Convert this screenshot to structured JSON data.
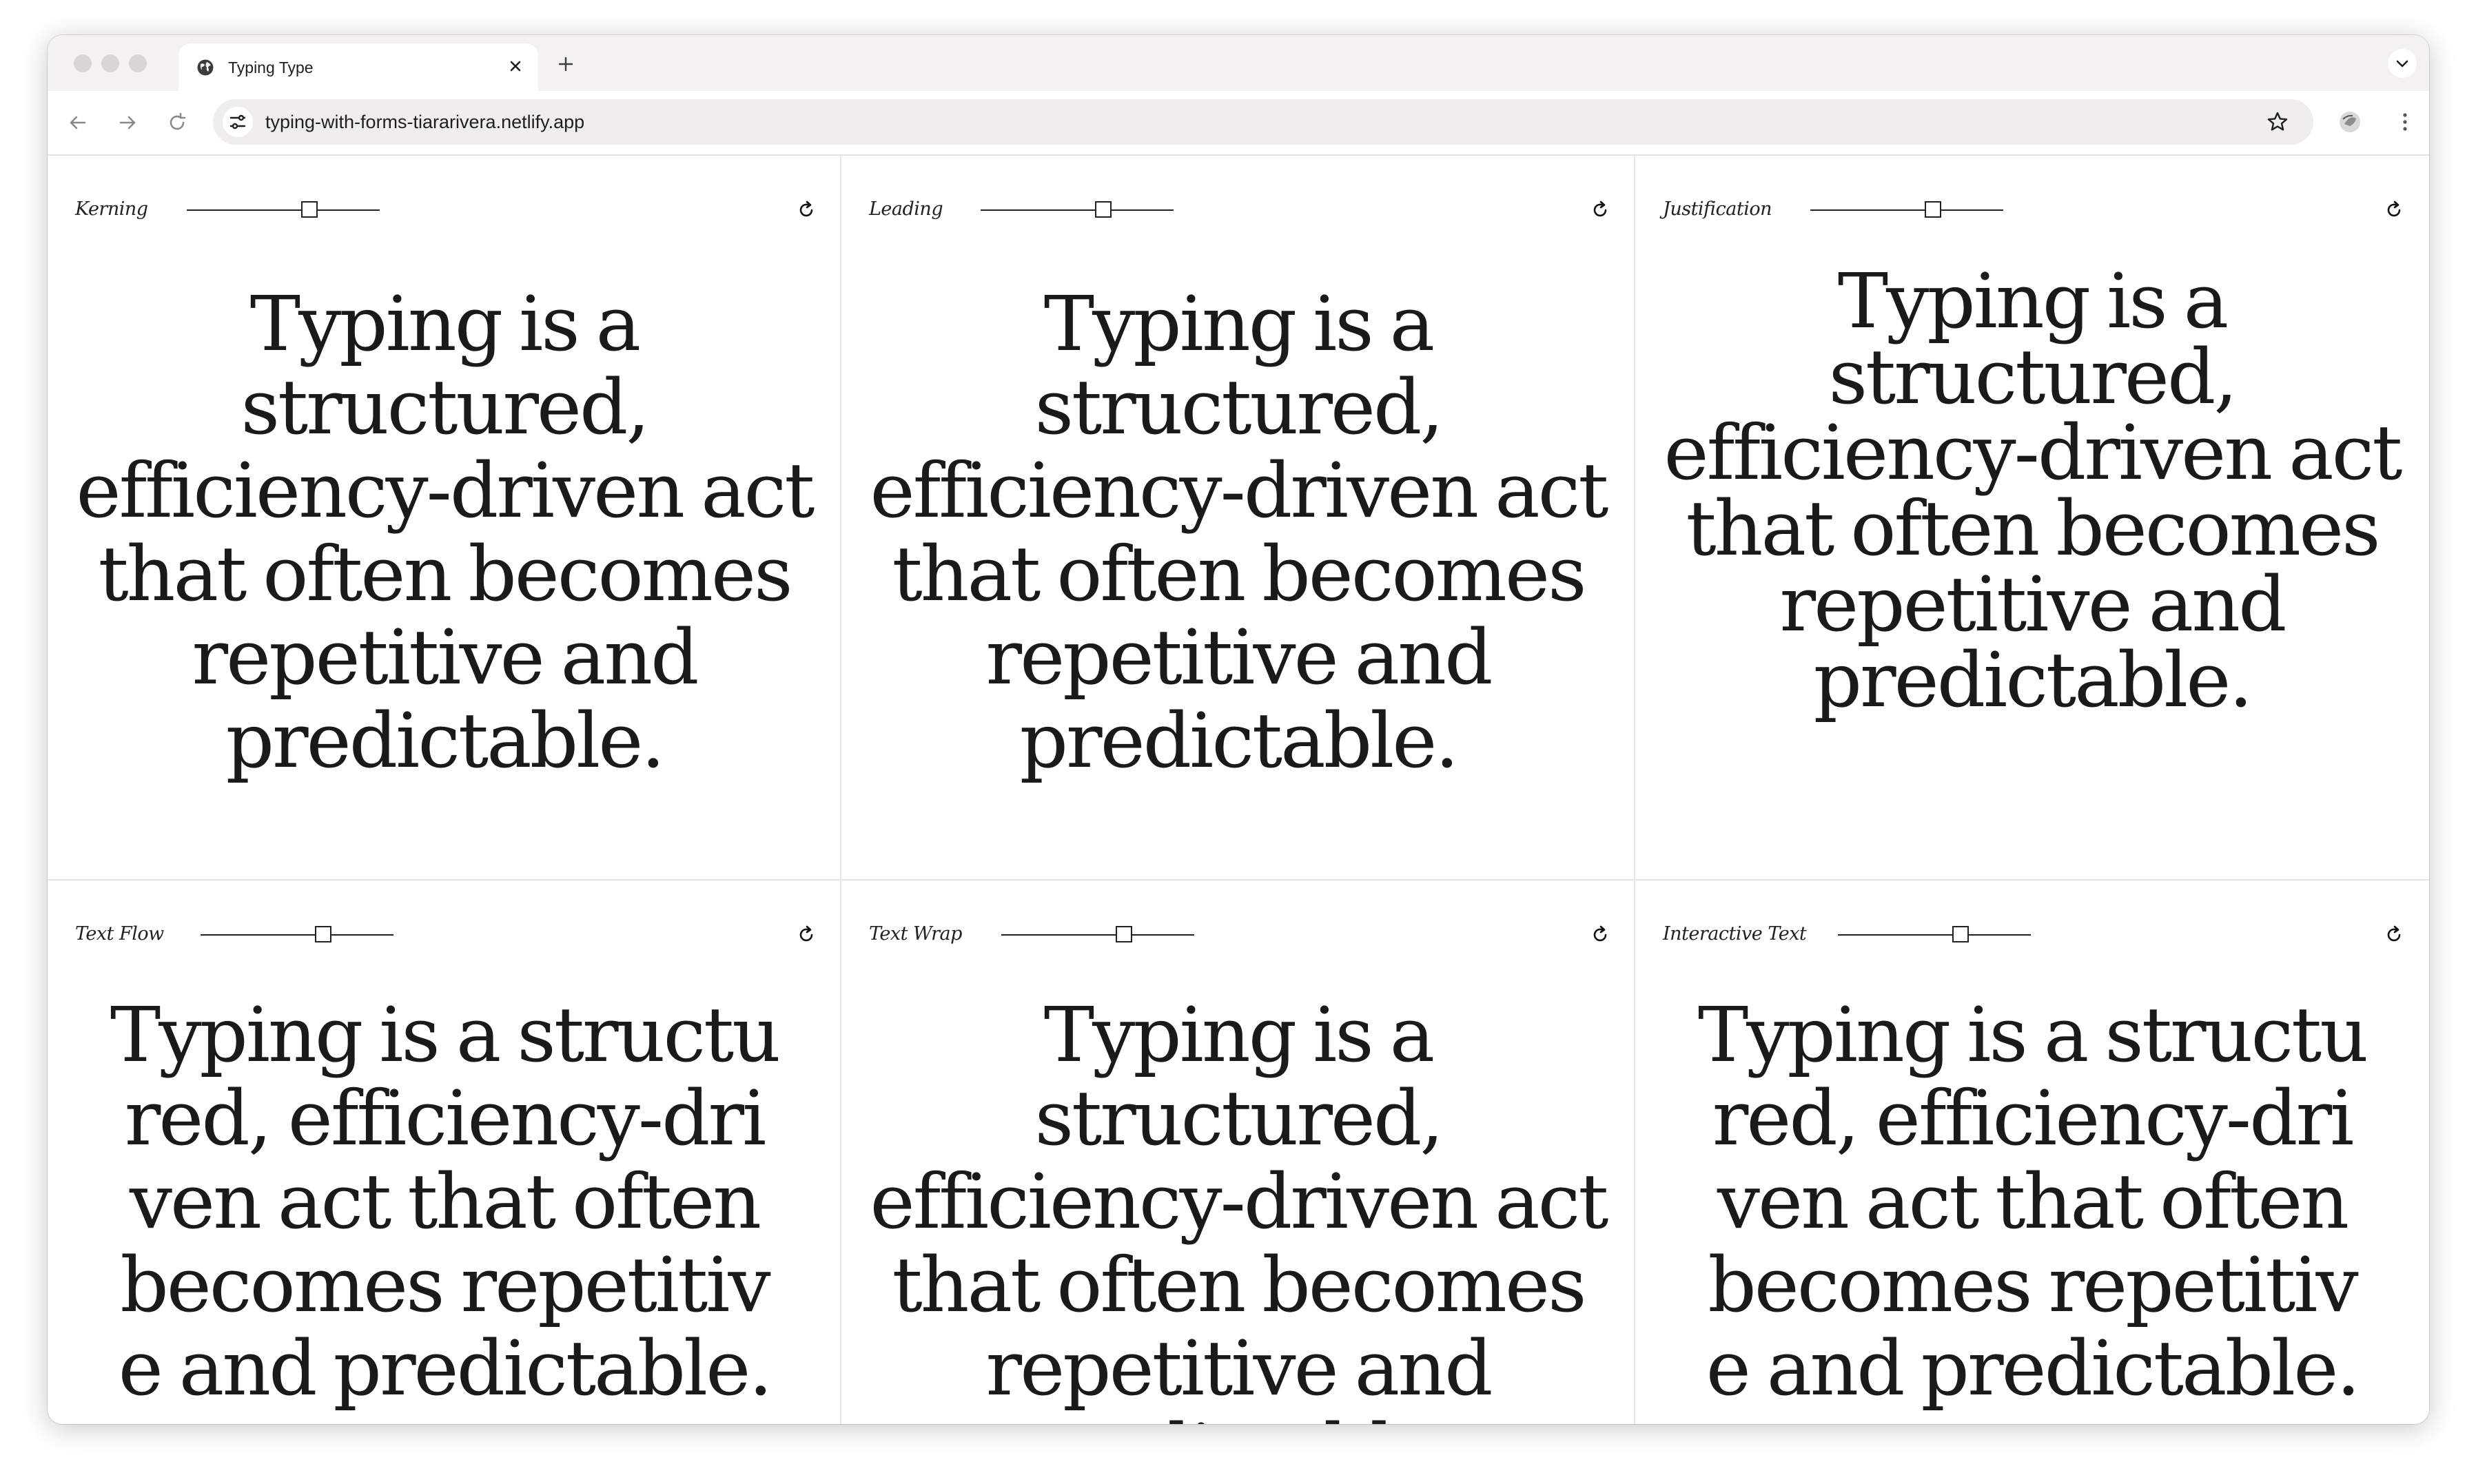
{
  "browser": {
    "tab_title": "Typing Type",
    "url": "typing-with-forms-tiararivera.netlify.app"
  },
  "panels": [
    {
      "label": "Kerning",
      "slider_value": 0.65,
      "lines": [
        "Typing is a",
        "structured,",
        "efficiency-driven act",
        "that often becomes",
        "repetitive and",
        "predictable."
      ]
    },
    {
      "label": "Leading",
      "slider_value": 0.65,
      "lines": [
        "Typing is a",
        "structured,",
        "efficiency-driven act",
        "that often becomes",
        "repetitive and",
        "predictable."
      ]
    },
    {
      "label": "Justification",
      "slider_value": 0.65,
      "lines": [
        "Typing is a",
        "structured,",
        "efficiency-driven act",
        "that often becomes",
        "repetitive and",
        "predictable."
      ]
    },
    {
      "label": "Text Flow",
      "slider_value": 0.65,
      "lines": [
        "Typing is a structu",
        "red, efficiency-dri",
        "ven act that often",
        "becomes repetitiv",
        "e and predictable."
      ]
    },
    {
      "label": "Text Wrap",
      "slider_value": 0.65,
      "lines": [
        "Typing is a",
        "structured,",
        "efficiency-driven act",
        "that often becomes",
        "repetitive and",
        "predictable."
      ]
    },
    {
      "label": "Interactive Text",
      "slider_value": 0.65,
      "lines": [
        "Typing is a structu",
        "red, efficiency-dri",
        "ven act that often",
        "becomes repetitiv",
        "e and predictable."
      ]
    }
  ]
}
